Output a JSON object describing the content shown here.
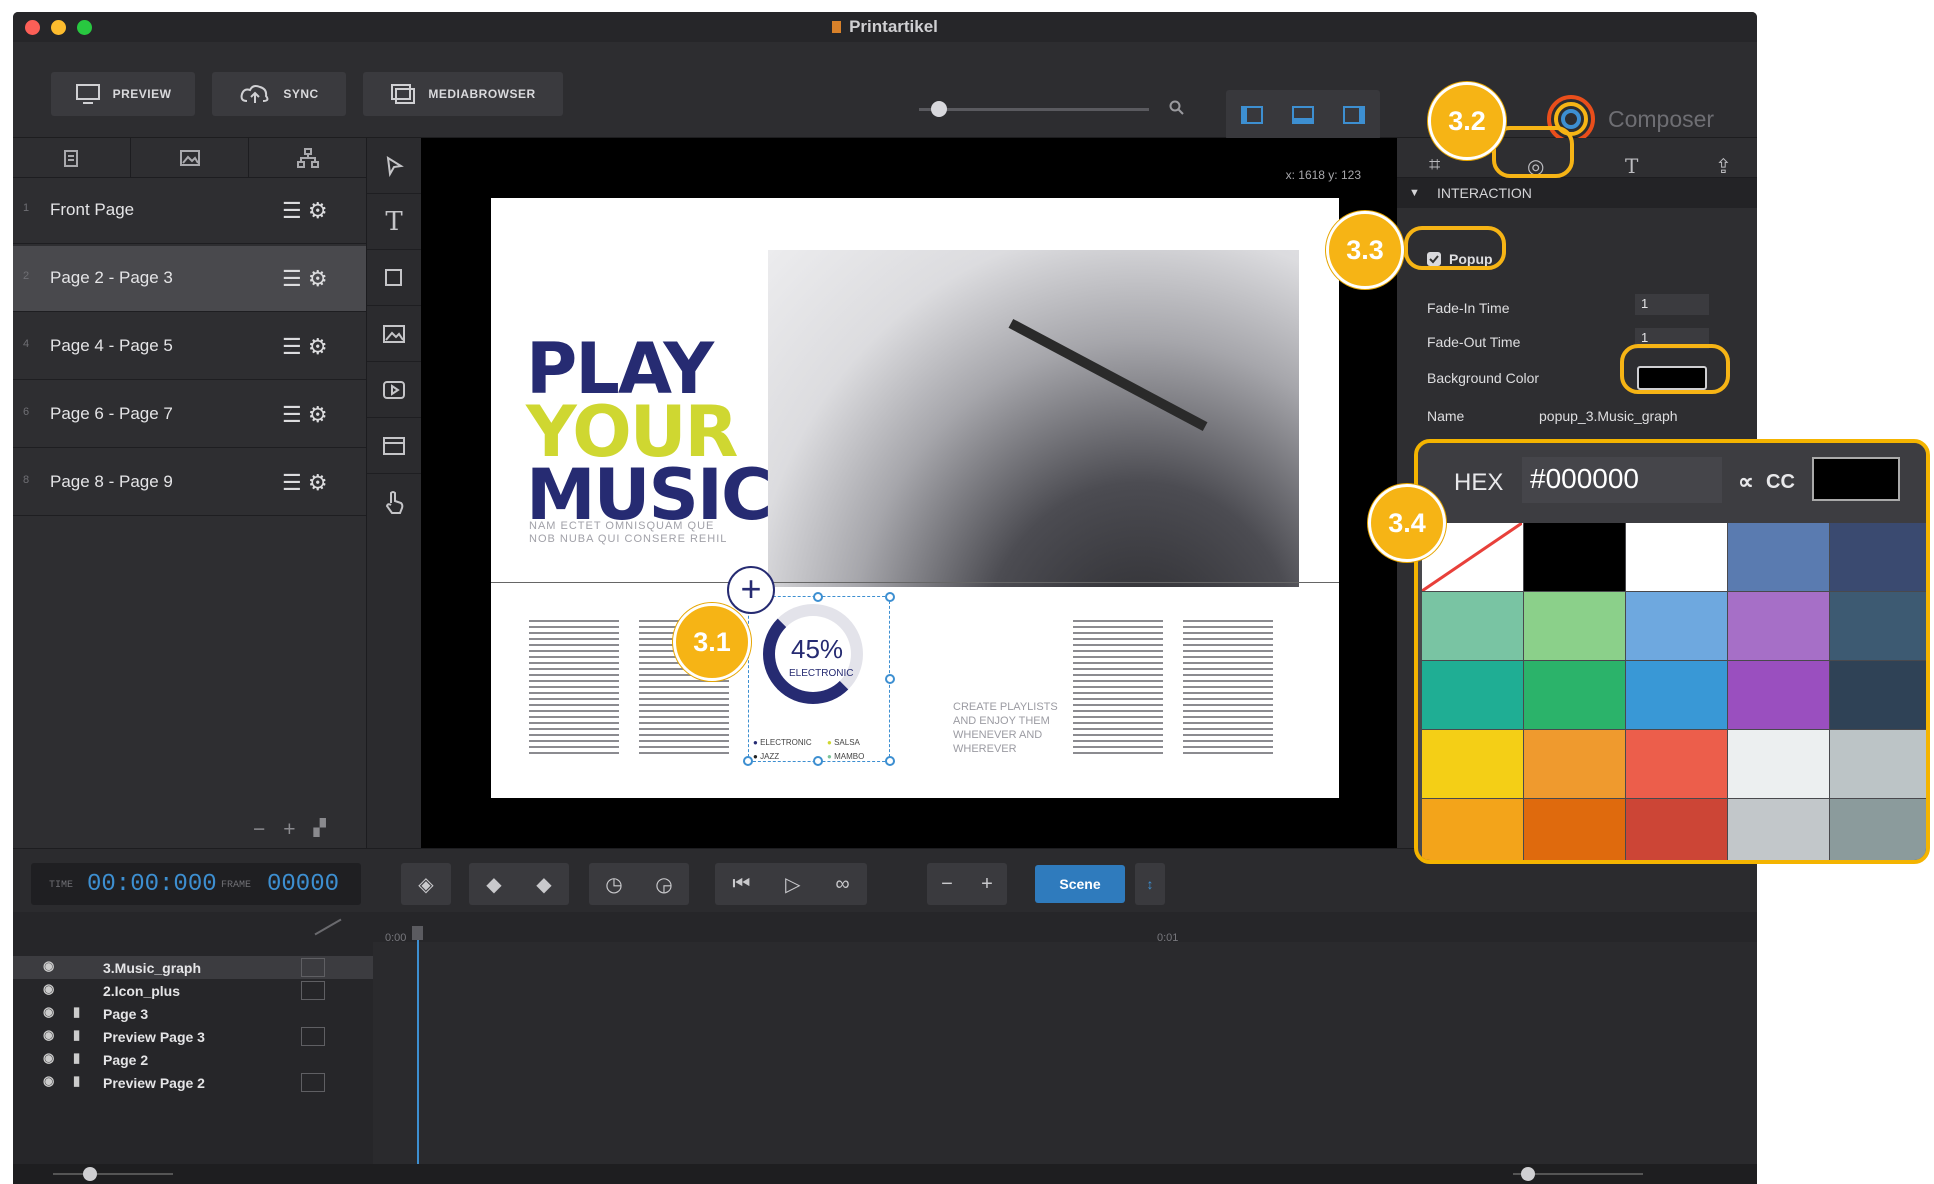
{
  "app": {
    "title": "Printartikel",
    "brand": "Composer"
  },
  "toolbar": {
    "preview": "PREVIEW",
    "sync": "SYNC",
    "mediabrowser": "MEDIABROWSER"
  },
  "pages": [
    {
      "num": "1",
      "label": "Front Page"
    },
    {
      "num": "2",
      "label": "Page 2 - Page 3"
    },
    {
      "num": "4",
      "label": "Page 4 - Page 5"
    },
    {
      "num": "6",
      "label": "Page 6 - Page 7"
    },
    {
      "num": "8",
      "label": "Page 8 - Page 9"
    }
  ],
  "canvas": {
    "coords": "x: 1618 y: 123",
    "headline": [
      "PLAY",
      "YOUR",
      "MUSIC"
    ],
    "subline": "NAM ECTET OMNISQUAM QUE NOB NUBA QUI CONSERE REHIL",
    "side_text": "CREATE PLAYLISTS AND ENJOY THEM WHENEVER AND WHEREVER",
    "chart_percent": "45%",
    "chart_label": "ELECTRONIC",
    "legend": [
      "ELECTRONIC",
      "SALSA",
      "JAZZ",
      "MAMBO"
    ]
  },
  "inspector": {
    "section": "INTERACTION",
    "popup_label": "Popup",
    "fade_in_label": "Fade-In Time",
    "fade_in_value": "1",
    "fade_out_label": "Fade-Out Time",
    "fade_out_value": "1",
    "bg_label": "Background Color",
    "name_label": "Name",
    "name_value": "popup_3.Music_graph"
  },
  "color_picker": {
    "hex_label": "HEX",
    "hex_value": "#000000",
    "alpha_label": "CC",
    "swatches": [
      "#ffffff",
      "#000000",
      "#ffffff",
      "#5a7bb0",
      "#3a4a70",
      "#79c4a3",
      "#8bd08a",
      "#6ea8df",
      "#a66fc7",
      "#3d5a72",
      "#1fae94",
      "#2bb36a",
      "#3998d6",
      "#9a4fbf",
      "#2f4256",
      "#f4cf16",
      "#ef9a2e",
      "#ec5e4b",
      "#eceff0",
      "#bcc4c6",
      "#f3a41a",
      "#df6a0d",
      "#cc4536",
      "#c2c7ca",
      "#8b9b9c"
    ]
  },
  "timeline": {
    "time_label": "TIME",
    "time": "00:00:000",
    "frame_label": "FRAME",
    "frame": "00000",
    "scene": "Scene",
    "mark_start": "0:00",
    "mark_end": "0:01"
  },
  "layers": [
    {
      "name": "3.Music_graph",
      "lock": false,
      "thumb": true
    },
    {
      "name": "2.Icon_plus",
      "lock": false,
      "thumb": true
    },
    {
      "name": "Page 3",
      "lock": true,
      "thumb": false
    },
    {
      "name": "Preview Page 3",
      "lock": true,
      "thumb": true
    },
    {
      "name": "Page 2",
      "lock": true,
      "thumb": false
    },
    {
      "name": "Preview Page 2",
      "lock": true,
      "thumb": true
    }
  ],
  "callouts": [
    "3.1",
    "3.2",
    "3.3",
    "3.4"
  ]
}
